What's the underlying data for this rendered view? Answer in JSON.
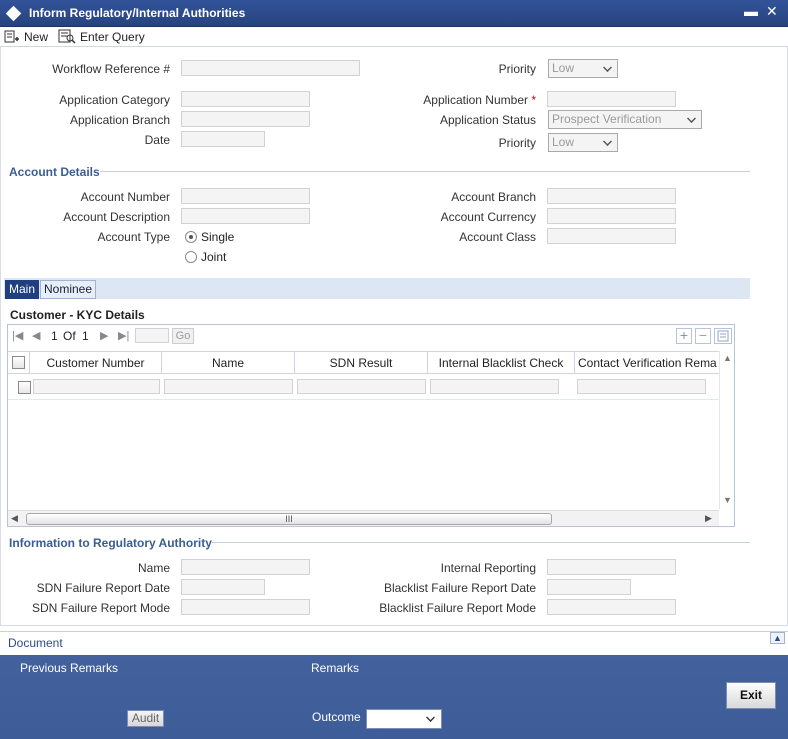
{
  "window": {
    "title": "Inform Regulatory/Internal Authorities",
    "minimize": "▬",
    "close": "✕"
  },
  "toolbar": {
    "new_label": "New",
    "enter_query_label": "Enter Query"
  },
  "header": {
    "workflow_ref_label": "Workflow Reference #",
    "priority_label": "Priority",
    "priority_value": "Low",
    "app_category_label": "Application Category",
    "app_branch_label": "Application Branch",
    "date_label": "Date",
    "app_number_label": "Application Number",
    "required_mark": "*",
    "app_status_label": "Application Status",
    "app_status_value": "Prospect Verification",
    "priority2_label": "Priority",
    "priority2_value": "Low"
  },
  "account": {
    "section_title": "Account Details",
    "number_label": "Account Number",
    "description_label": "Account Description",
    "type_label": "Account Type",
    "type_single": "Single",
    "type_joint": "Joint",
    "branch_label": "Account Branch",
    "currency_label": "Account Currency",
    "class_label": "Account Class"
  },
  "tabs": [
    {
      "label": "Main",
      "active": true
    },
    {
      "label": "Nominee",
      "active": false
    }
  ],
  "kyc": {
    "title": "Customer - KYC Details",
    "page_current": "1",
    "page_of": "Of",
    "page_total": "1",
    "go_label": "Go",
    "columns": [
      "Customer Number",
      "Name",
      "SDN Result",
      "Internal Blacklist Check",
      "Contact Verification Rema"
    ],
    "scroll_thumb": "III"
  },
  "regulatory": {
    "section_title": "Information to Regulatory Authority",
    "name_label": "Name",
    "sdn_date_label": "SDN Failure Report Date",
    "sdn_mode_label": "SDN Failure Report Mode",
    "internal_reporting_label": "Internal Reporting",
    "blacklist_date_label": "Blacklist Failure Report Date",
    "blacklist_mode_label": "Blacklist Failure Report Mode"
  },
  "document": {
    "label": "Document"
  },
  "footer": {
    "previous_remarks_label": "Previous Remarks",
    "remarks_label": "Remarks",
    "audit_label": "Audit",
    "outcome_label": "Outcome",
    "exit_label": "Exit"
  }
}
